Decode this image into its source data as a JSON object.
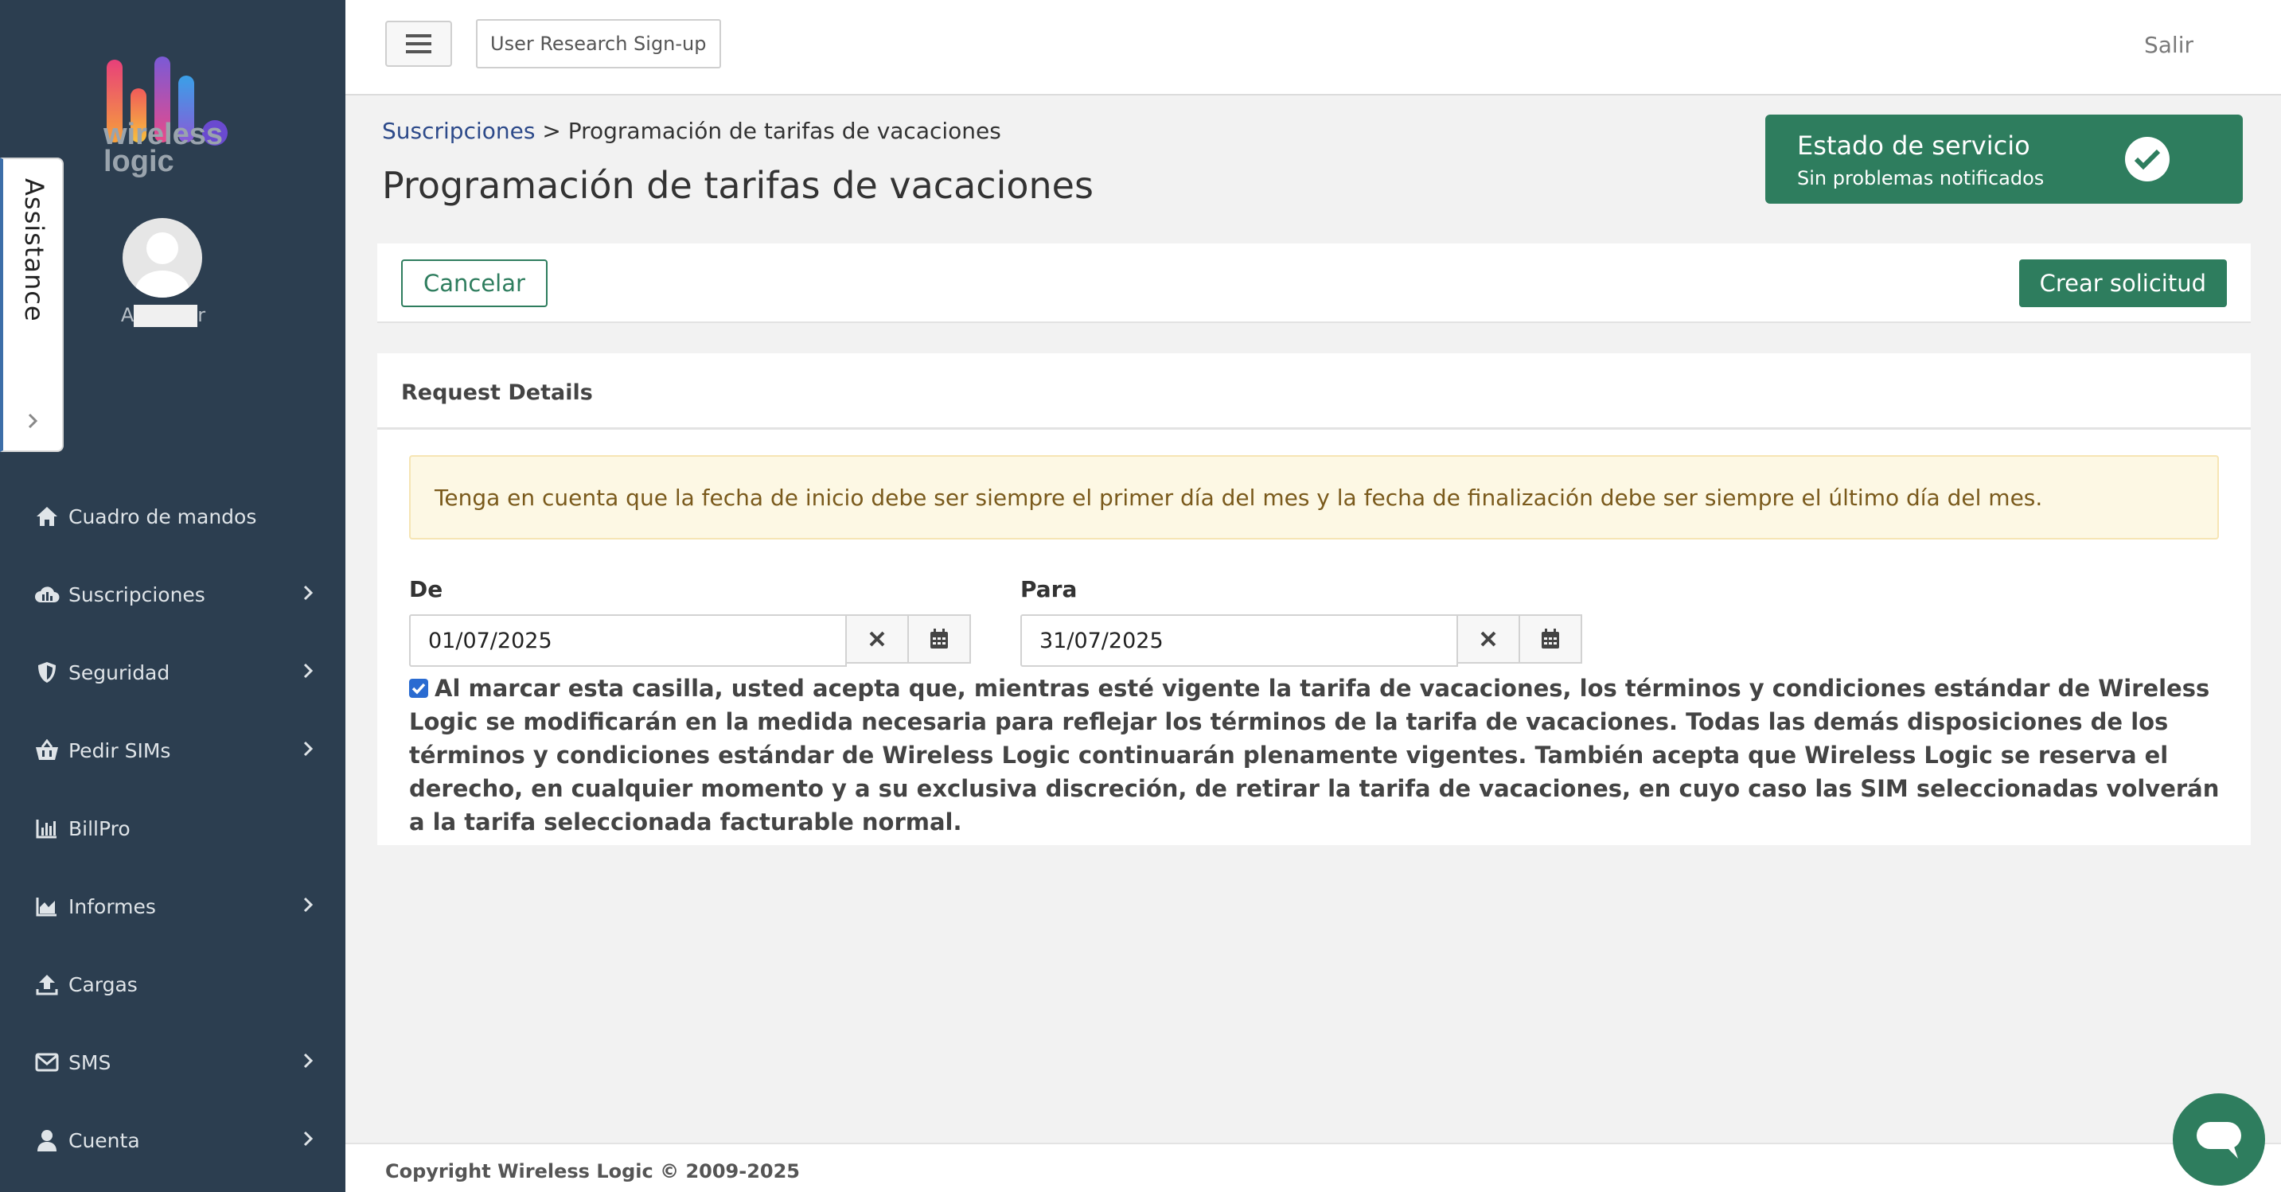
{
  "brand": {
    "name": "wireless logic"
  },
  "user": {
    "name_visible_start": "A",
    "name_visible_end": "r"
  },
  "assistance": {
    "label": "Assistance"
  },
  "sidebar": {
    "items": [
      {
        "label": "Cuadro de mandos",
        "icon": "home-icon",
        "has_submenu": false
      },
      {
        "label": "Suscripciones",
        "icon": "cloud-icon",
        "has_submenu": true
      },
      {
        "label": "Seguridad",
        "icon": "shield-icon",
        "has_submenu": true
      },
      {
        "label": "Pedir SIMs",
        "icon": "basket-icon",
        "has_submenu": true
      },
      {
        "label": "BillPro",
        "icon": "bar-chart-icon",
        "has_submenu": false
      },
      {
        "label": "Informes",
        "icon": "area-chart-icon",
        "has_submenu": true
      },
      {
        "label": "Cargas",
        "icon": "upload-icon",
        "has_submenu": false
      },
      {
        "label": "SMS",
        "icon": "envelope-icon",
        "has_submenu": true
      },
      {
        "label": "Cuenta",
        "icon": "user-icon",
        "has_submenu": true
      }
    ]
  },
  "topbar": {
    "research_label": "User Research Sign-up",
    "logout_label": "Salir"
  },
  "breadcrumb": {
    "parent": "Suscripciones",
    "separator": ">",
    "current": "Programación de tarifas de vacaciones"
  },
  "page": {
    "title": "Programación de tarifas de vacaciones"
  },
  "status": {
    "title": "Estado de servicio",
    "subtitle": "Sin problemas notificados",
    "color": "#2e7d5e"
  },
  "actions": {
    "cancel_label": "Cancelar",
    "create_label": "Crear solicitud"
  },
  "details": {
    "heading": "Request Details",
    "notice": "Tenga en cuenta que la fecha de inicio debe ser siempre el primer día del mes y la fecha de finalización debe ser siempre el último día del mes.",
    "from_label": "De",
    "from_value": "01/07/2025",
    "to_label": "Para",
    "to_value": "31/07/2025",
    "agree_checked": true,
    "agree_text": "Al marcar esta casilla, usted acepta que, mientras esté vigente la tarifa de vacaciones, los términos y condiciones estándar de Wireless Logic se modificarán en la medida necesaria para reflejar los términos de la tarifa de vacaciones. Todas las demás disposiciones de los términos y condiciones estándar de Wireless Logic continuarán plenamente vigentes. También acepta que Wireless Logic se reserva el derecho, en cualquier momento y a su exclusiva discreción, de retirar la tarifa de vacaciones, en cuyo caso las SIM seleccionadas volverán a la tarifa seleccionada facturable normal."
  },
  "footer": {
    "copyright": "Copyright Wireless Logic © 2009-2025"
  }
}
